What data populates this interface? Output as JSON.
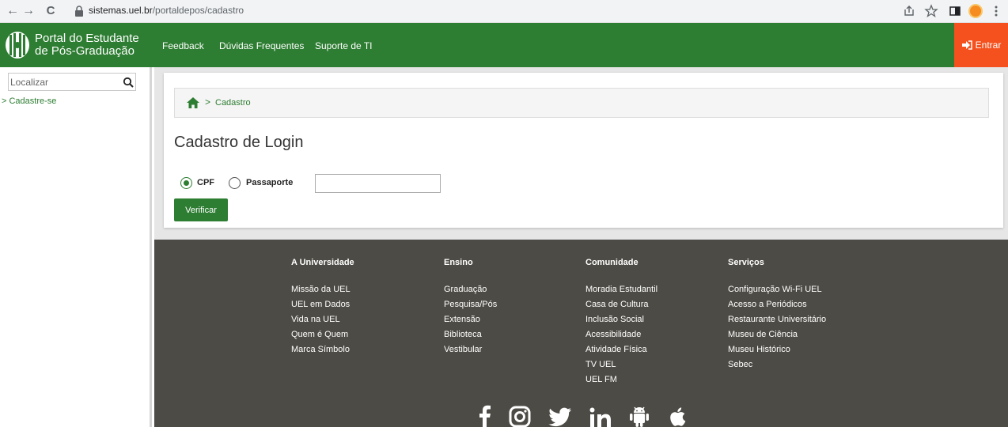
{
  "browser": {
    "back": "←",
    "forward": "→",
    "reload": "C",
    "url_host": "sistemas.uel.br",
    "url_path": "/portaldepos/cadastro"
  },
  "header": {
    "title_line1": "Portal do Estudante",
    "title_line2": "de Pós-Graduação",
    "nav": [
      "Feedback",
      "Dúvidas Frequentes",
      "Suporte de TI"
    ],
    "login_label": "Entrar",
    "bg_color": "#2d7d32",
    "login_color": "#f4511e"
  },
  "sidebar": {
    "search_placeholder": "Localizar",
    "link": "> Cadastre-se"
  },
  "breadcrumb": {
    "separator": ">",
    "current": "Cadastro"
  },
  "form": {
    "title": "Cadastro de Login",
    "option_cpf": "CPF",
    "option_passport": "Passaporte",
    "selected": "CPF",
    "document_value": "",
    "submit_label": "Verificar"
  },
  "footer": {
    "columns": [
      {
        "heading": "A Universidade",
        "items": [
          "Missão da UEL",
          "UEL em Dados",
          "Vida na UEL",
          "Quem é Quem",
          "Marca Símbolo"
        ]
      },
      {
        "heading": "Ensino",
        "items": [
          "Graduação",
          "Pesquisa/Pós",
          "Extensão",
          "Biblioteca",
          "Vestibular"
        ]
      },
      {
        "heading": "Comunidade",
        "items": [
          "Moradia Estudantil",
          "Casa de Cultura",
          "Inclusão Social",
          "Acessibilidade",
          "Atividade Física",
          "TV UEL",
          "UEL FM"
        ]
      },
      {
        "heading": "Serviços",
        "items": [
          "Configuração Wi-Fi UEL",
          "Acesso a Periódicos",
          "Restaurante Universitário",
          "Museu de Ciência",
          "Museu Histórico",
          "Sebec"
        ]
      }
    ],
    "social_icons": [
      "facebook-icon",
      "instagram-icon",
      "twitter-icon",
      "linkedin-icon",
      "android-icon",
      "apple-icon"
    ],
    "bg_color": "#4d4b45"
  }
}
